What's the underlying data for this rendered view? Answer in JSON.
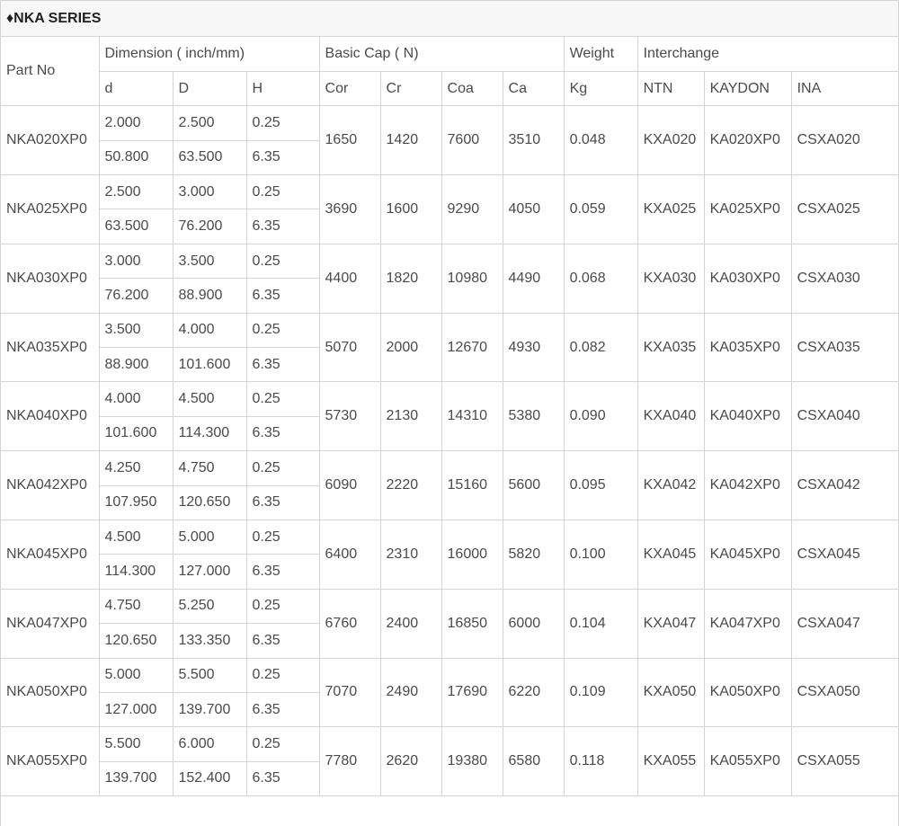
{
  "title": "♦NKA SERIES",
  "header": {
    "part_no": "Part No",
    "groups": {
      "dimension": "Dimension ( inch/mm)",
      "basic_cap": "Basic Cap ( N)",
      "weight": "Weight",
      "interchange": "Interchange"
    },
    "sub": {
      "d": "d",
      "D": "D",
      "H": "H",
      "Cor": "Cor",
      "Cr": "Cr",
      "Coa": "Coa",
      "Ca": "Ca",
      "Kg": "Kg",
      "NTN": "NTN",
      "KAYDON": "KAYDON",
      "INA": "INA"
    }
  },
  "rows": [
    {
      "part": "NKA020XP0",
      "inch": {
        "d": "2.000",
        "D": "2.500",
        "H": "0.25"
      },
      "mm": {
        "d": "50.800",
        "D": "63.500",
        "H": "6.35"
      },
      "cor": "1650",
      "cr": "1420",
      "coa": "7600",
      "ca": "3510",
      "kg": "0.048",
      "ntn": "KXA020",
      "kaydon": "KA020XP0",
      "ina": "CSXA020"
    },
    {
      "part": "NKA025XP0",
      "inch": {
        "d": "2.500",
        "D": "3.000",
        "H": "0.25"
      },
      "mm": {
        "d": "63.500",
        "D": "76.200",
        "H": "6.35"
      },
      "cor": "3690",
      "cr": "1600",
      "coa": "9290",
      "ca": "4050",
      "kg": "0.059",
      "ntn": "KXA025",
      "kaydon": "KA025XP0",
      "ina": "CSXA025"
    },
    {
      "part": "NKA030XP0",
      "inch": {
        "d": "3.000",
        "D": "3.500",
        "H": "0.25"
      },
      "mm": {
        "d": "76.200",
        "D": "88.900",
        "H": "6.35"
      },
      "cor": "4400",
      "cr": "1820",
      "coa": "10980",
      "ca": "4490",
      "kg": "0.068",
      "ntn": "KXA030",
      "kaydon": "KA030XP0",
      "ina": "CSXA030"
    },
    {
      "part": "NKA035XP0",
      "inch": {
        "d": "3.500",
        "D": "4.000",
        "H": "0.25"
      },
      "mm": {
        "d": "88.900",
        "D": "101.600",
        "H": "6.35"
      },
      "cor": "5070",
      "cr": "2000",
      "coa": "12670",
      "ca": "4930",
      "kg": "0.082",
      "ntn": "KXA035",
      "kaydon": "KA035XP0",
      "ina": "CSXA035"
    },
    {
      "part": "NKA040XP0",
      "inch": {
        "d": "4.000",
        "D": "4.500",
        "H": "0.25"
      },
      "mm": {
        "d": "101.600",
        "D": "114.300",
        "H": "6.35"
      },
      "cor": "5730",
      "cr": "2130",
      "coa": "14310",
      "ca": "5380",
      "kg": "0.090",
      "ntn": "KXA040",
      "kaydon": "KA040XP0",
      "ina": "CSXA040"
    },
    {
      "part": "NKA042XP0",
      "inch": {
        "d": "4.250",
        "D": "4.750",
        "H": "0.25"
      },
      "mm": {
        "d": "107.950",
        "D": "120.650",
        "H": "6.35"
      },
      "cor": "6090",
      "cr": "2220",
      "coa": "15160",
      "ca": "5600",
      "kg": "0.095",
      "ntn": "KXA042",
      "kaydon": "KA042XP0",
      "ina": "CSXA042"
    },
    {
      "part": "NKA045XP0",
      "inch": {
        "d": "4.500",
        "D": "5.000",
        "H": "0.25"
      },
      "mm": {
        "d": "114.300",
        "D": "127.000",
        "H": "6.35"
      },
      "cor": "6400",
      "cr": "2310",
      "coa": "16000",
      "ca": "5820",
      "kg": "0.100",
      "ntn": "KXA045",
      "kaydon": "KA045XP0",
      "ina": "CSXA045"
    },
    {
      "part": "NKA047XP0",
      "inch": {
        "d": "4.750",
        "D": "5.250",
        "H": "0.25"
      },
      "mm": {
        "d": "120.650",
        "D": "133.350",
        "H": "6.35"
      },
      "cor": "6760",
      "cr": "2400",
      "coa": "16850",
      "ca": "6000",
      "kg": "0.104",
      "ntn": "KXA047",
      "kaydon": "KA047XP0",
      "ina": "CSXA047"
    },
    {
      "part": "NKA050XP0",
      "inch": {
        "d": "5.000",
        "D": "5.500",
        "H": "0.25"
      },
      "mm": {
        "d": "127.000",
        "D": "139.700",
        "H": "6.35"
      },
      "cor": "7070",
      "cr": "2490",
      "coa": "17690",
      "ca": "6220",
      "kg": "0.109",
      "ntn": "KXA050",
      "kaydon": "KA050XP0",
      "ina": "CSXA050"
    },
    {
      "part": "NKA055XP0",
      "inch": {
        "d": "5.500",
        "D": "6.000",
        "H": "0.25"
      },
      "mm": {
        "d": "139.700",
        "D": "152.400",
        "H": "6.35"
      },
      "cor": "7780",
      "cr": "2620",
      "coa": "19380",
      "ca": "6580",
      "kg": "0.118",
      "ntn": "KXA055",
      "kaydon": "KA055XP0",
      "ina": "CSXA055"
    }
  ]
}
